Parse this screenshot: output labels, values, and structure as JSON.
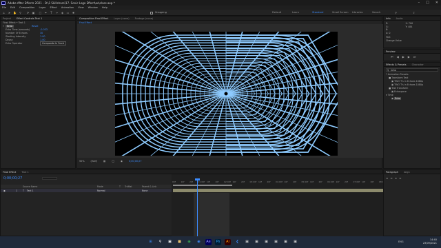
{
  "window": {
    "title": "Adobe After Effects 2021 - D:\\1 Skillshare\\17. Sonic Logo Effect\\ae\\class.aep *"
  },
  "menu": [
    "File",
    "Edit",
    "Composition",
    "Layer",
    "Effect",
    "Animation",
    "View",
    "Window",
    "Help"
  ],
  "toolbar": {
    "snapping_label": "Snapping",
    "workspaces": [
      "Default",
      "Learn",
      "Standard",
      "Small Screen",
      "Libraries",
      "Search"
    ],
    "active_workspace": "Standard"
  },
  "project_panel": {
    "tabs": [
      "Project",
      "Effect Controls Text 1"
    ],
    "subtitle": "Final Effect • Text 1",
    "effect_name": "Echo",
    "reset_label": "Reset",
    "properties": [
      {
        "name": "Echo Time (seconds)",
        "value": "-0.033"
      },
      {
        "name": "Number Of Echoes",
        "value": "30"
      },
      {
        "name": "Starting Intensity",
        "value": "1.00"
      },
      {
        "name": "Decay",
        "value": "1.00"
      },
      {
        "name": "Echo Operator",
        "value": "Composite In Front"
      }
    ]
  },
  "composition": {
    "tabs": [
      "Composition Final Effect",
      "Layer (none)",
      "Footage (none)"
    ],
    "subtab": "Final Effect",
    "viewer_bar": {
      "zoom": "50%",
      "quality": "(Half)",
      "timecode": "0;00;00;27"
    }
  },
  "info_panel": {
    "tabs": [
      "Info",
      "Audio"
    ],
    "lines": [
      "R:",
      "G:",
      "B:",
      "A: 0",
      "X: 700",
      "Y: 484",
      "Text",
      "Change Value"
    ]
  },
  "preview_panel": {
    "title": "Preview"
  },
  "effects_presets": {
    "tabs": [
      "Effects & Presets",
      "Character"
    ],
    "search_value": "echo",
    "tree": [
      "* Animation Presets",
      "Transform Text",
      "TWO T's in Echoes 1080p",
      "TWO T's in Echoes 1080p",
      "Text Transform",
      "Echospace",
      "Time",
      "Echo"
    ]
  },
  "timeline": {
    "tabs": [
      "Final Effect",
      "Text 1"
    ],
    "timecode": "0;00;00;27",
    "columns": [
      "Source Name",
      "Mode",
      "T",
      "TrkMat",
      "Parent & Link"
    ],
    "layer": {
      "index": "1",
      "name": "Text 1",
      "mode": "Normal",
      "parent": "None"
    },
    "ruler": [
      "00f",
      "10f",
      "20f",
      "01:00f",
      "10f",
      "20f",
      "02:00f",
      "10f",
      "20f",
      "03:00f",
      "10f",
      "20f",
      "04:00f",
      "10f",
      "20f",
      "05:00f",
      "10f",
      "20f",
      "06:00f",
      "10f",
      "20f",
      "07:00f",
      "10f",
      "20f",
      "08:00f"
    ],
    "playhead_fraction": 0.11
  },
  "paragraph_panel": {
    "tabs": [
      "Paragraph",
      "Align"
    ]
  },
  "taskbar": {
    "time": "14:40",
    "date": "23/09/2021",
    "lang": "ENG"
  },
  "colors": {
    "accent": "#3c8cff",
    "line": "#8ecbff",
    "canvas": "#000000",
    "layer_bar": "#8c8a6c"
  }
}
